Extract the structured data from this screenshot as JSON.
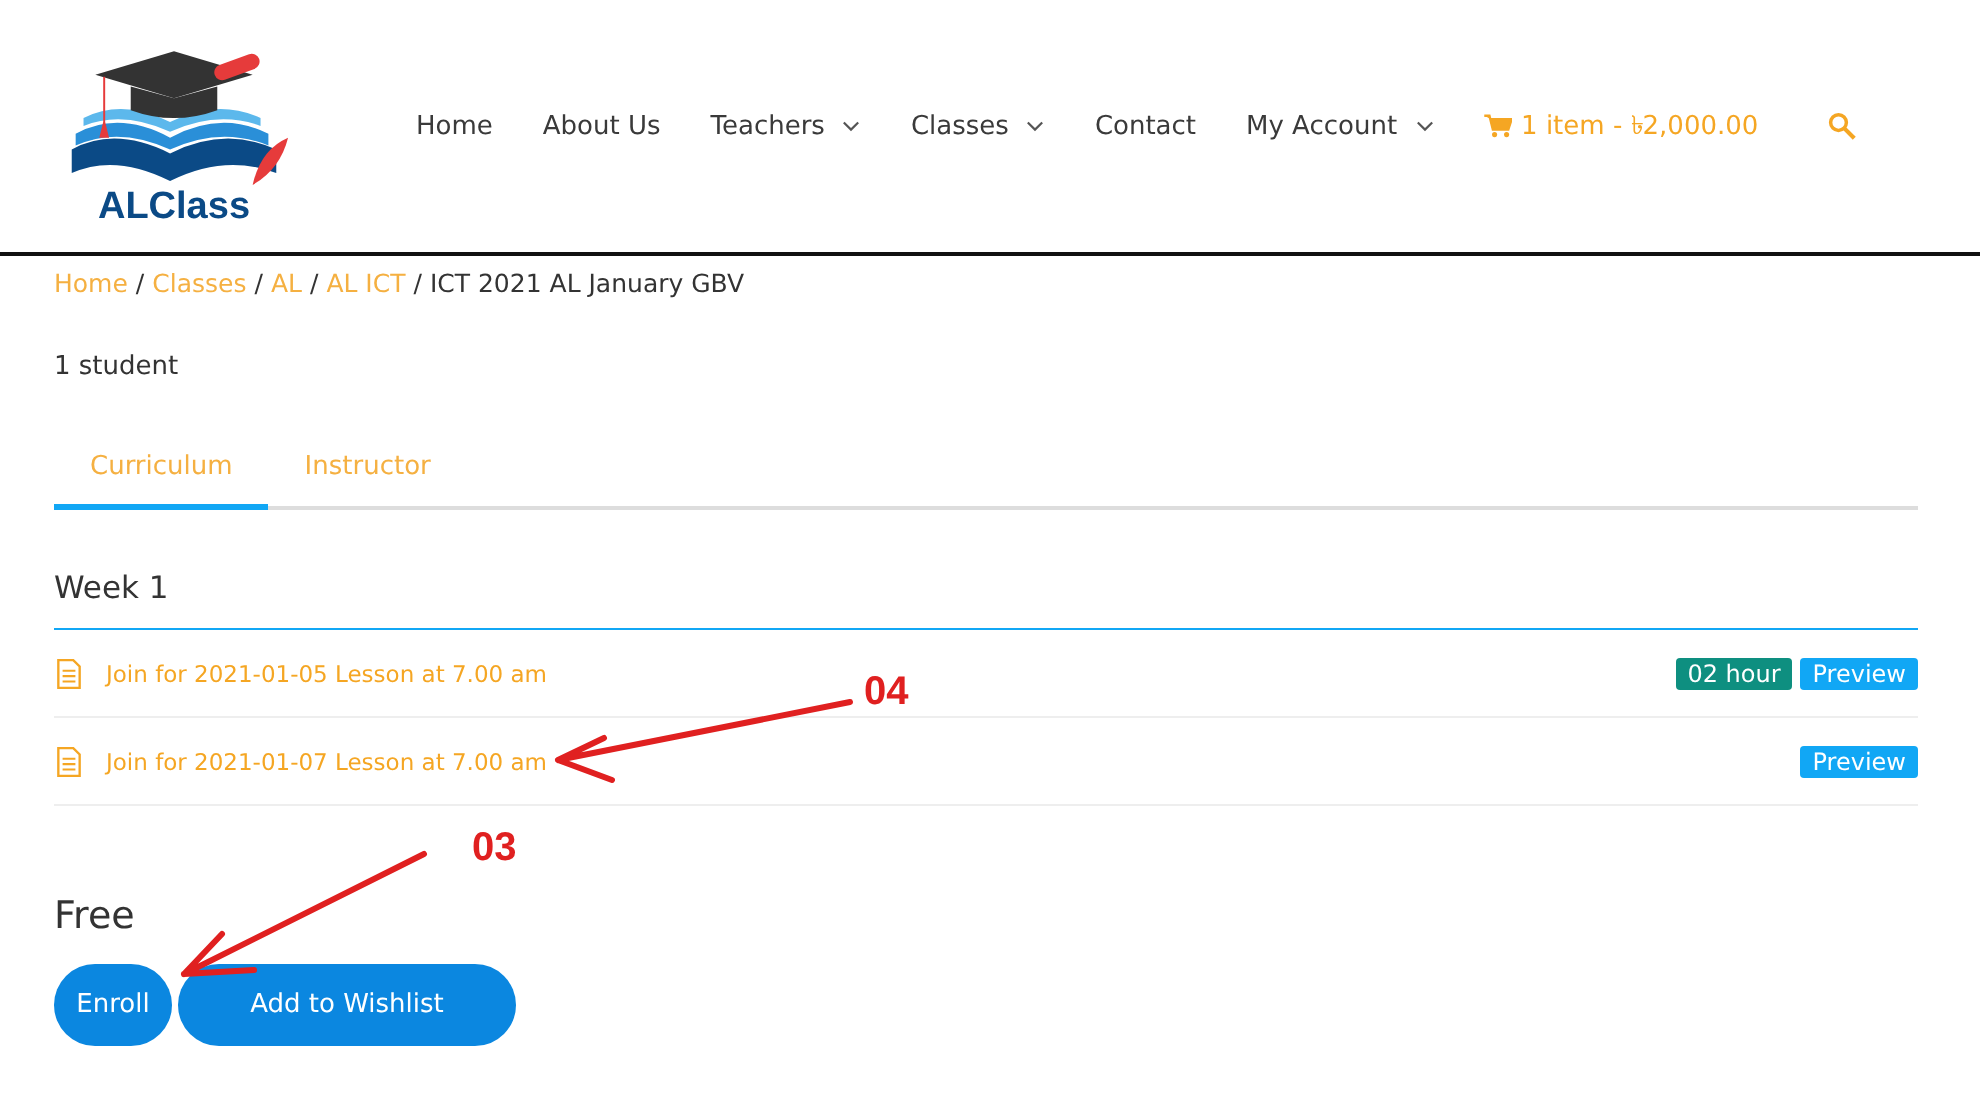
{
  "logo": {
    "text": "ALClass"
  },
  "nav": [
    {
      "label": "Home",
      "kind": "link",
      "has_dropdown": false
    },
    {
      "label": "About Us",
      "kind": "link",
      "has_dropdown": false
    },
    {
      "label": "Teachers",
      "kind": "link",
      "has_dropdown": true
    },
    {
      "label": "Classes",
      "kind": "link",
      "has_dropdown": true
    },
    {
      "label": "Contact",
      "kind": "link",
      "has_dropdown": false
    },
    {
      "label": "My Account",
      "kind": "link",
      "has_dropdown": true
    },
    {
      "label": "1 item - ৳2,000.00",
      "kind": "cart"
    },
    {
      "kind": "search"
    }
  ],
  "breadcrumb": [
    {
      "text": "Home",
      "kind": "link"
    },
    {
      "text": "/",
      "kind": "separator"
    },
    {
      "text": "Classes",
      "kind": "link"
    },
    {
      "text": "/",
      "kind": "separator"
    },
    {
      "text": "AL",
      "kind": "link"
    },
    {
      "text": "/",
      "kind": "separator"
    },
    {
      "text": "AL ICT",
      "kind": "link"
    },
    {
      "text": "/",
      "kind": "separator"
    },
    {
      "text": "ICT 2021 AL January GBV",
      "kind": "current"
    }
  ],
  "students": "1 student",
  "tabs": [
    {
      "label": "Curriculum",
      "selected": true
    },
    {
      "label": "Instructor",
      "selected": false
    }
  ],
  "section": {
    "title": "Week 1",
    "lessons": [
      {
        "title": "Join for 2021-01-05 Lesson at 7.00 am",
        "duration": "02 hour",
        "preview": "Preview"
      },
      {
        "title": "Join for 2021-01-07 Lesson at 7.00 am",
        "preview": "Preview"
      }
    ]
  },
  "price": "Free",
  "buttons": [
    "Enroll",
    "Add to Wishlist"
  ],
  "annotations": [
    {
      "label": "04",
      "kind": "lesson"
    },
    {
      "label": "03",
      "kind": "enroll"
    }
  ]
}
